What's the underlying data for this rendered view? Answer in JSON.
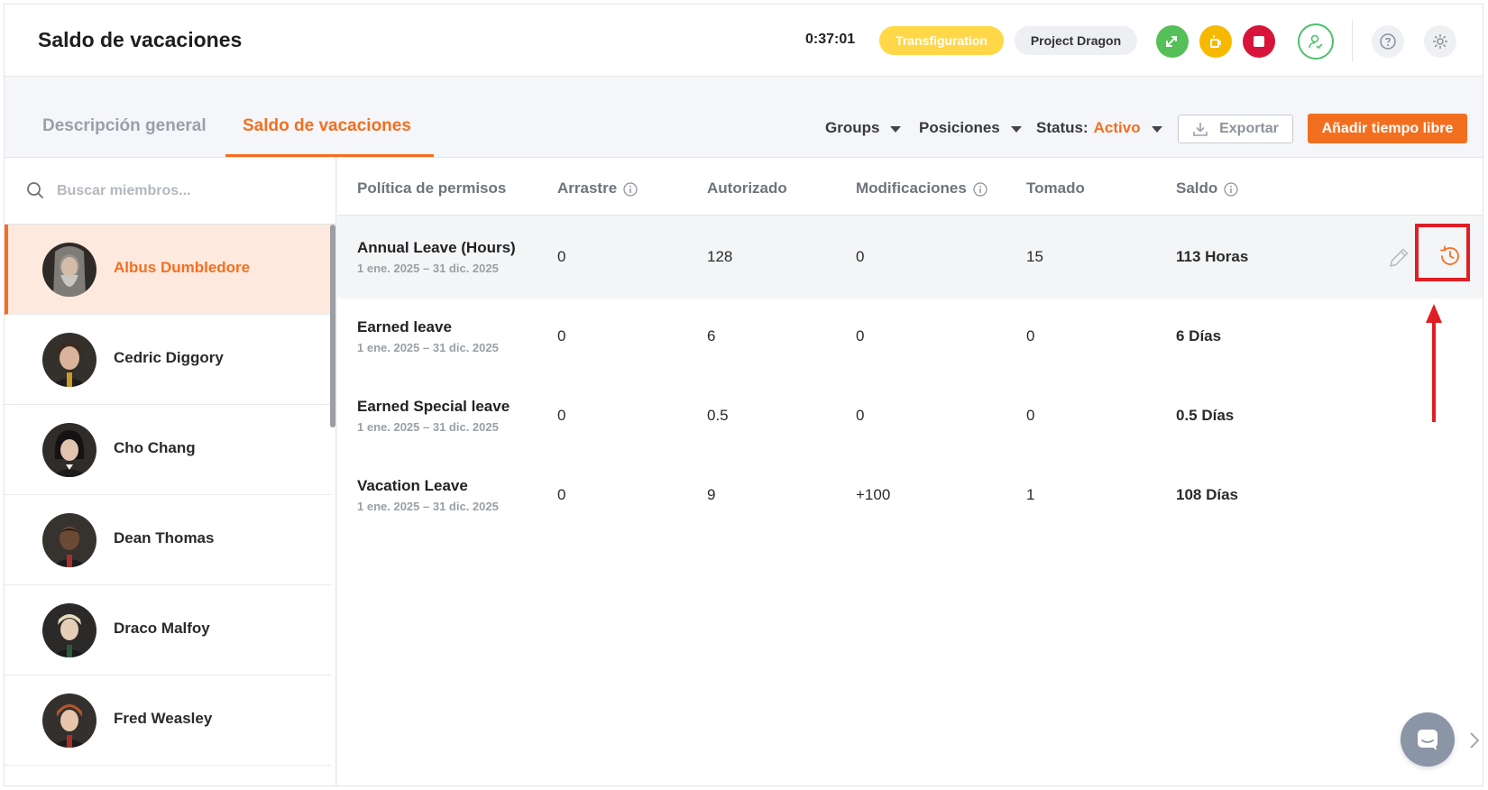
{
  "header": {
    "title": "Saldo de vacaciones",
    "timer": "0:37:01",
    "task_pill": "Transfiguration",
    "project_pill": "Project Dragon"
  },
  "tabs": [
    {
      "label": "Descripción general",
      "active": false
    },
    {
      "label": "Saldo de vacaciones",
      "active": true
    }
  ],
  "filters": {
    "groups": "Groups",
    "positions": "Posiciones",
    "status_label": "Status",
    "status_value": "Activo",
    "export_label": "Exportar",
    "add_label": "Añadir tiempo libre"
  },
  "search": {
    "placeholder": "Buscar miembros..."
  },
  "members": [
    {
      "name": "Albus Dumbledore",
      "active": true
    },
    {
      "name": "Cedric Diggory",
      "active": false
    },
    {
      "name": "Cho Chang",
      "active": false
    },
    {
      "name": "Dean Thomas",
      "active": false
    },
    {
      "name": "Draco Malfoy",
      "active": false
    },
    {
      "name": "Fred Weasley",
      "active": false
    }
  ],
  "table": {
    "columns": {
      "policy": "Política de permisos",
      "carry": "Arrastre",
      "authorized": "Autorizado",
      "modifications": "Modificaciones",
      "taken": "Tomado",
      "balance": "Saldo"
    },
    "rows": [
      {
        "policy": "Annual Leave (Hours)",
        "dates": "1 ene. 2025 – 31 dic. 2025",
        "carry": "0",
        "authorized": "128",
        "modifications": "0",
        "taken": "15",
        "balance": "113 Horas"
      },
      {
        "policy": "Earned leave",
        "dates": "1 ene. 2025 – 31 dic. 2025",
        "carry": "0",
        "authorized": "6",
        "modifications": "0",
        "taken": "0",
        "balance": "6 Días"
      },
      {
        "policy": "Earned Special leave",
        "dates": "1 ene. 2025 – 31 dic. 2025",
        "carry": "0",
        "authorized": "0.5",
        "modifications": "0",
        "taken": "0",
        "balance": "0.5 Días"
      },
      {
        "policy": "Vacation Leave",
        "dates": "1 ene. 2025 – 31 dic. 2025",
        "carry": "0",
        "authorized": "9",
        "modifications": "+100",
        "taken": "1",
        "balance": "108 Días"
      }
    ]
  },
  "icons": {
    "search": "search-icon",
    "info": "info-icon",
    "edit": "pencil-icon",
    "history": "history-icon",
    "export": "download-icon",
    "chat": "chat-icon"
  },
  "colors": {
    "accent": "#f36f20",
    "highlight_box": "#e01e25",
    "task_pill": "#ffd747",
    "green_button": "#55c057",
    "yellow_button": "#f6b900",
    "red_button": "#d8143a"
  }
}
